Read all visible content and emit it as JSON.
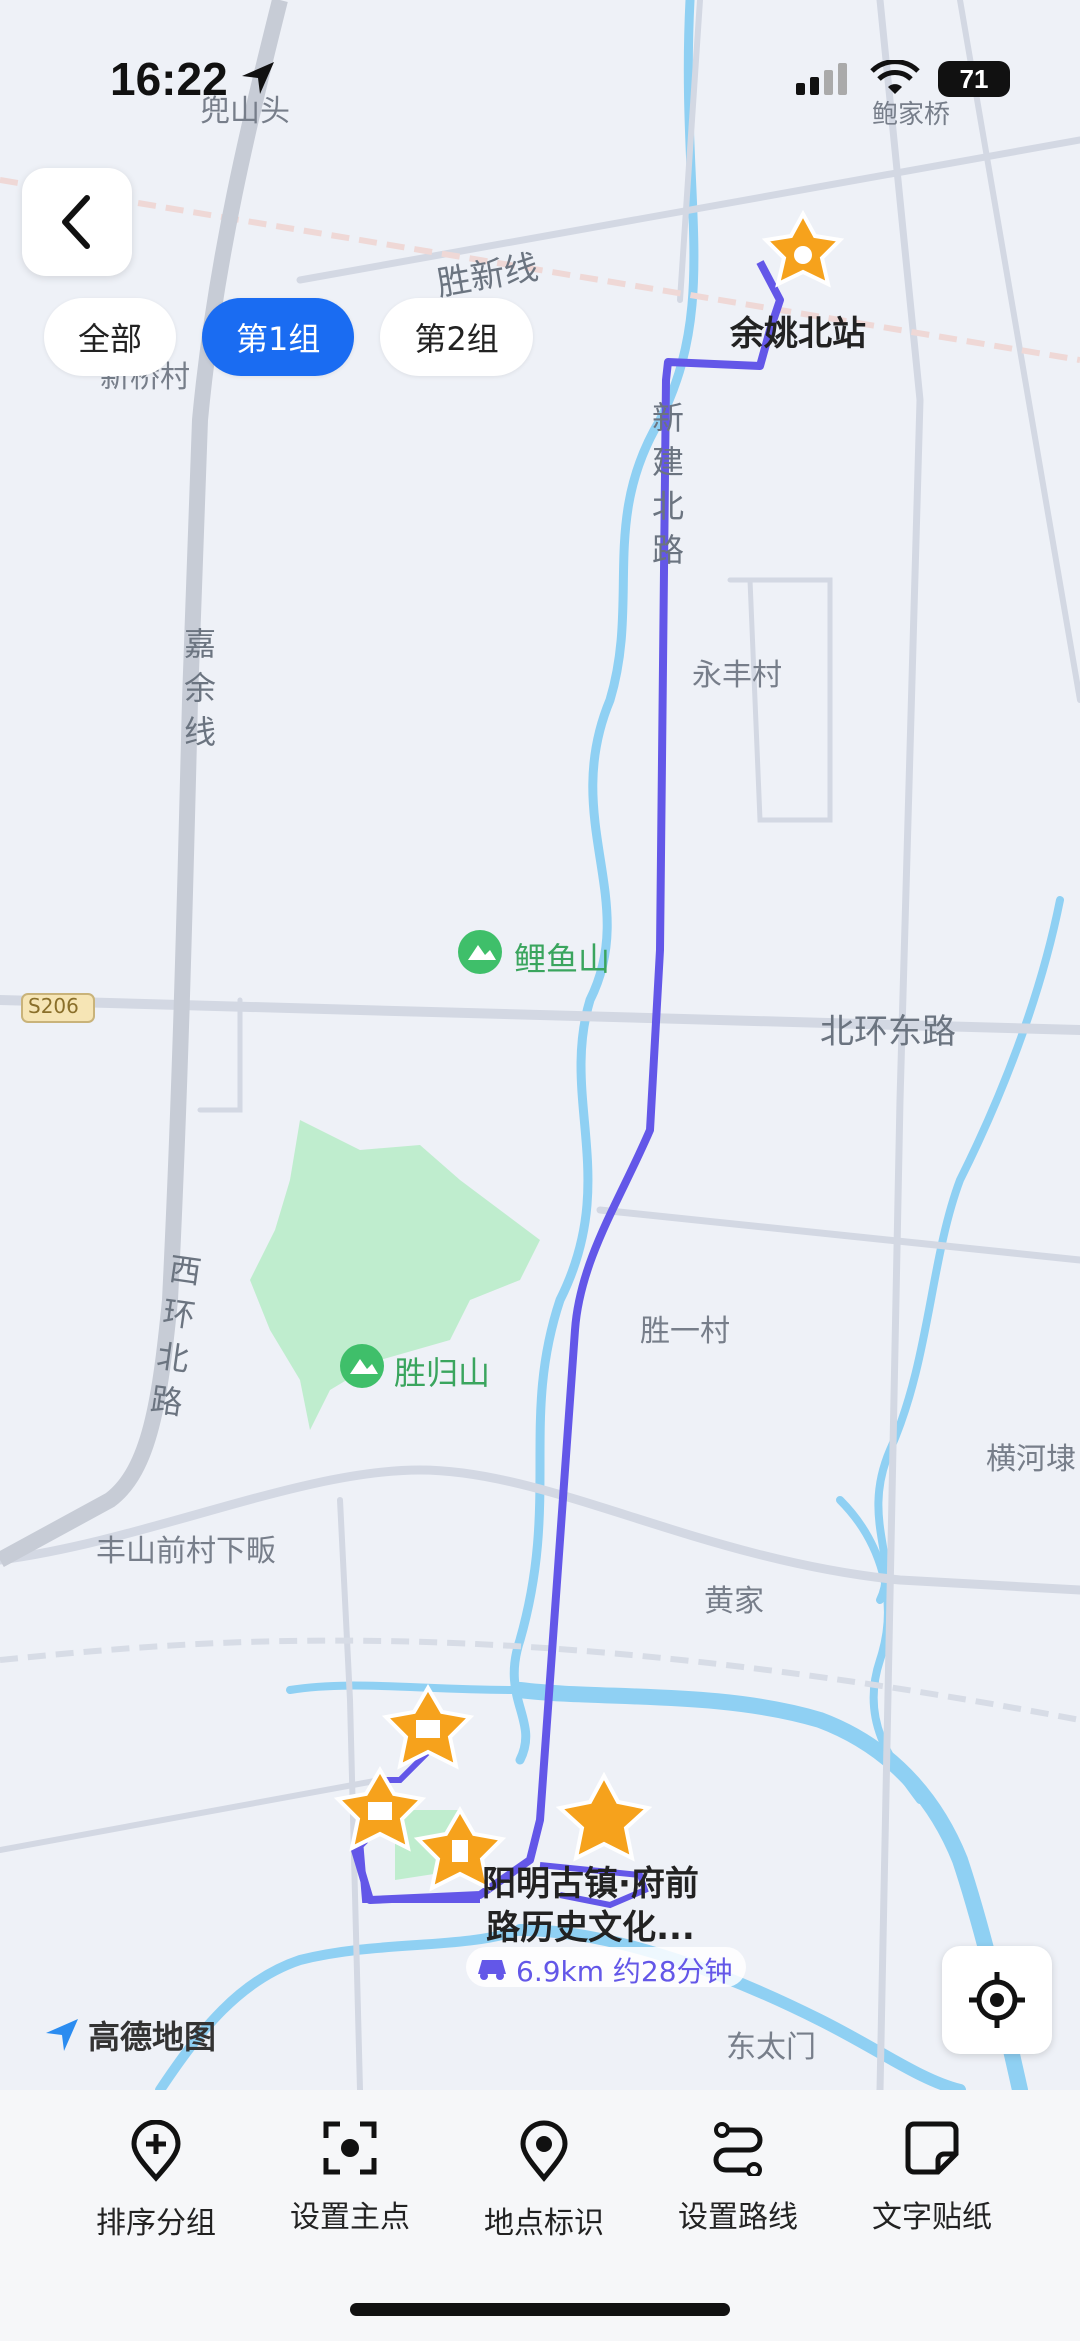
{
  "status_bar": {
    "time": "16:22",
    "battery": "71"
  },
  "group_tabs": [
    "全部",
    "第1组",
    "第2组"
  ],
  "map": {
    "route_info": "6.9km 约28分钟",
    "destination": "阳明古镇·府前路历史文化...",
    "destination_lines": [
      "阳明古镇·府前",
      "路历史文化..."
    ],
    "start": "余姚北站",
    "road_labels": {
      "shengxin": "胜新线",
      "xinjianbei": "新建北路",
      "jiayu": "嘉余线",
      "xihuanbei": "西环北路",
      "beihuandong": "北环东路",
      "s206": "S206"
    },
    "place_labels": {
      "yongfeng": "永丰村",
      "shengyi": "胜一村",
      "huangjia": "黄家",
      "fengshan": "丰山前村下畈",
      "dongtaimen": "东太门",
      "henghe": "横河埭",
      "doushantou": "兜山头",
      "baojiaqiao": "鲍家桥",
      "xinqiao": "新桥村",
      "liyushan": "鲤鱼山",
      "shenggui": "胜归山"
    },
    "brand": "高德地图"
  },
  "toolbar": [
    {
      "label": "排序分组",
      "icon": "add-pin-icon"
    },
    {
      "label": "设置主点",
      "icon": "focus-point-icon"
    },
    {
      "label": "地点标识",
      "icon": "location-pin-icon"
    },
    {
      "label": "设置路线",
      "icon": "route-icon"
    },
    {
      "label": "文字贴纸",
      "icon": "sticker-icon"
    }
  ]
}
